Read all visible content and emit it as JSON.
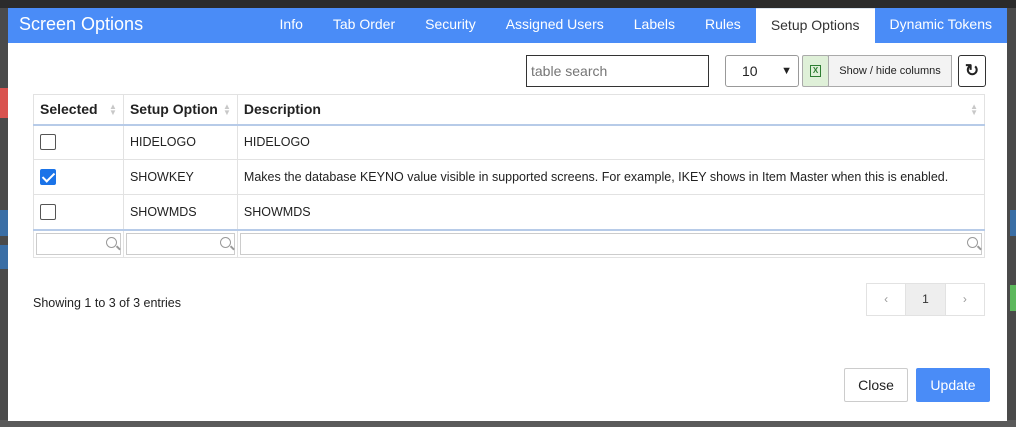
{
  "modal": {
    "title": "Screen Options",
    "tabs": [
      {
        "label": "Info"
      },
      {
        "label": "Tab Order"
      },
      {
        "label": "Security"
      },
      {
        "label": "Assigned Users"
      },
      {
        "label": "Labels"
      },
      {
        "label": "Rules"
      },
      {
        "label": "Setup Options",
        "active": true
      },
      {
        "label": "Dynamic Tokens"
      }
    ]
  },
  "toolbar": {
    "search_placeholder": "table search",
    "page_size": "10",
    "excel_icon": "excel-icon",
    "show_hide_label": "Show / hide columns",
    "refresh_icon": "refresh-icon"
  },
  "table": {
    "columns": [
      "Selected",
      "Setup Option",
      "Description"
    ],
    "rows": [
      {
        "selected": false,
        "option": "HIDELOGO",
        "description": "HIDELOGO"
      },
      {
        "selected": true,
        "option": "SHOWKEY",
        "description": "Makes the database KEYNO value visible in supported screens. For example, IKEY shows in Item Master when this is enabled."
      },
      {
        "selected": false,
        "option": "SHOWMDS",
        "description": "SHOWMDS"
      }
    ]
  },
  "footer": {
    "info": "Showing 1 to 3 of 3 entries",
    "pager": {
      "prev": "‹",
      "page": "1",
      "next": "›"
    },
    "close_label": "Close",
    "update_label": "Update"
  },
  "colors": {
    "accent": "#4a8cf7",
    "checkbox": "#1a73e8"
  }
}
